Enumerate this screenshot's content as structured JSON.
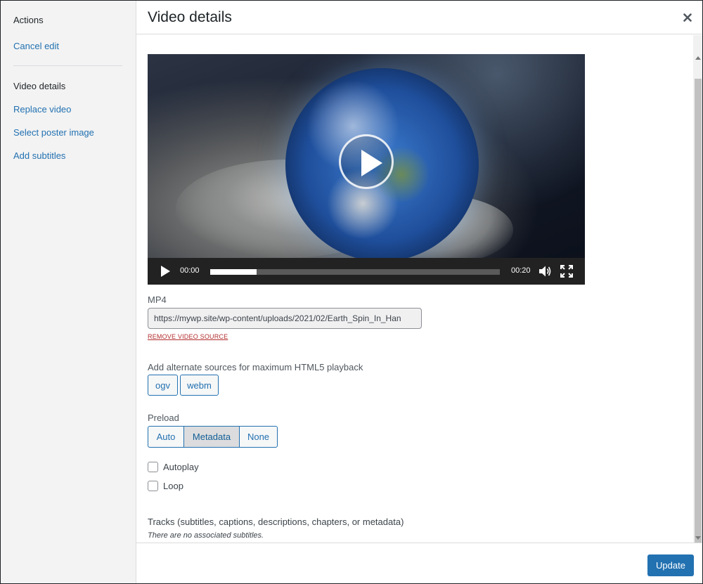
{
  "sidebar": {
    "heading_actions": "Actions",
    "cancel_edit": "Cancel edit",
    "heading_video_details": "Video details",
    "items": [
      {
        "label": "Replace video"
      },
      {
        "label": "Select poster image"
      },
      {
        "label": "Add subtitles"
      }
    ]
  },
  "header": {
    "title": "Video details",
    "close_icon": "close-icon"
  },
  "player": {
    "current_time": "00:00",
    "duration": "00:20",
    "buffered_fraction": 0.16,
    "icons": [
      "play-icon",
      "volume-icon",
      "fullscreen-icon"
    ]
  },
  "source": {
    "label": "MP4",
    "url": "https://mywp.site/wp-content/uploads/2021/02/Earth_Spin_In_Han",
    "remove_label": "REMOVE VIDEO SOURCE"
  },
  "alternate": {
    "label": "Add alternate sources for maximum HTML5 playback",
    "buttons": [
      "ogv",
      "webm"
    ]
  },
  "preload": {
    "label": "Preload",
    "options": [
      "Auto",
      "Metadata",
      "None"
    ],
    "selected": "Metadata"
  },
  "options": {
    "autoplay": "Autoplay",
    "loop": "Loop"
  },
  "tracks": {
    "label": "Tracks (subtitles, captions, descriptions, chapters, or metadata)",
    "note": "There are no associated subtitles."
  },
  "footer": {
    "update_label": "Update"
  },
  "colors": {
    "accent": "#2271b1",
    "danger": "#b32d2e"
  }
}
